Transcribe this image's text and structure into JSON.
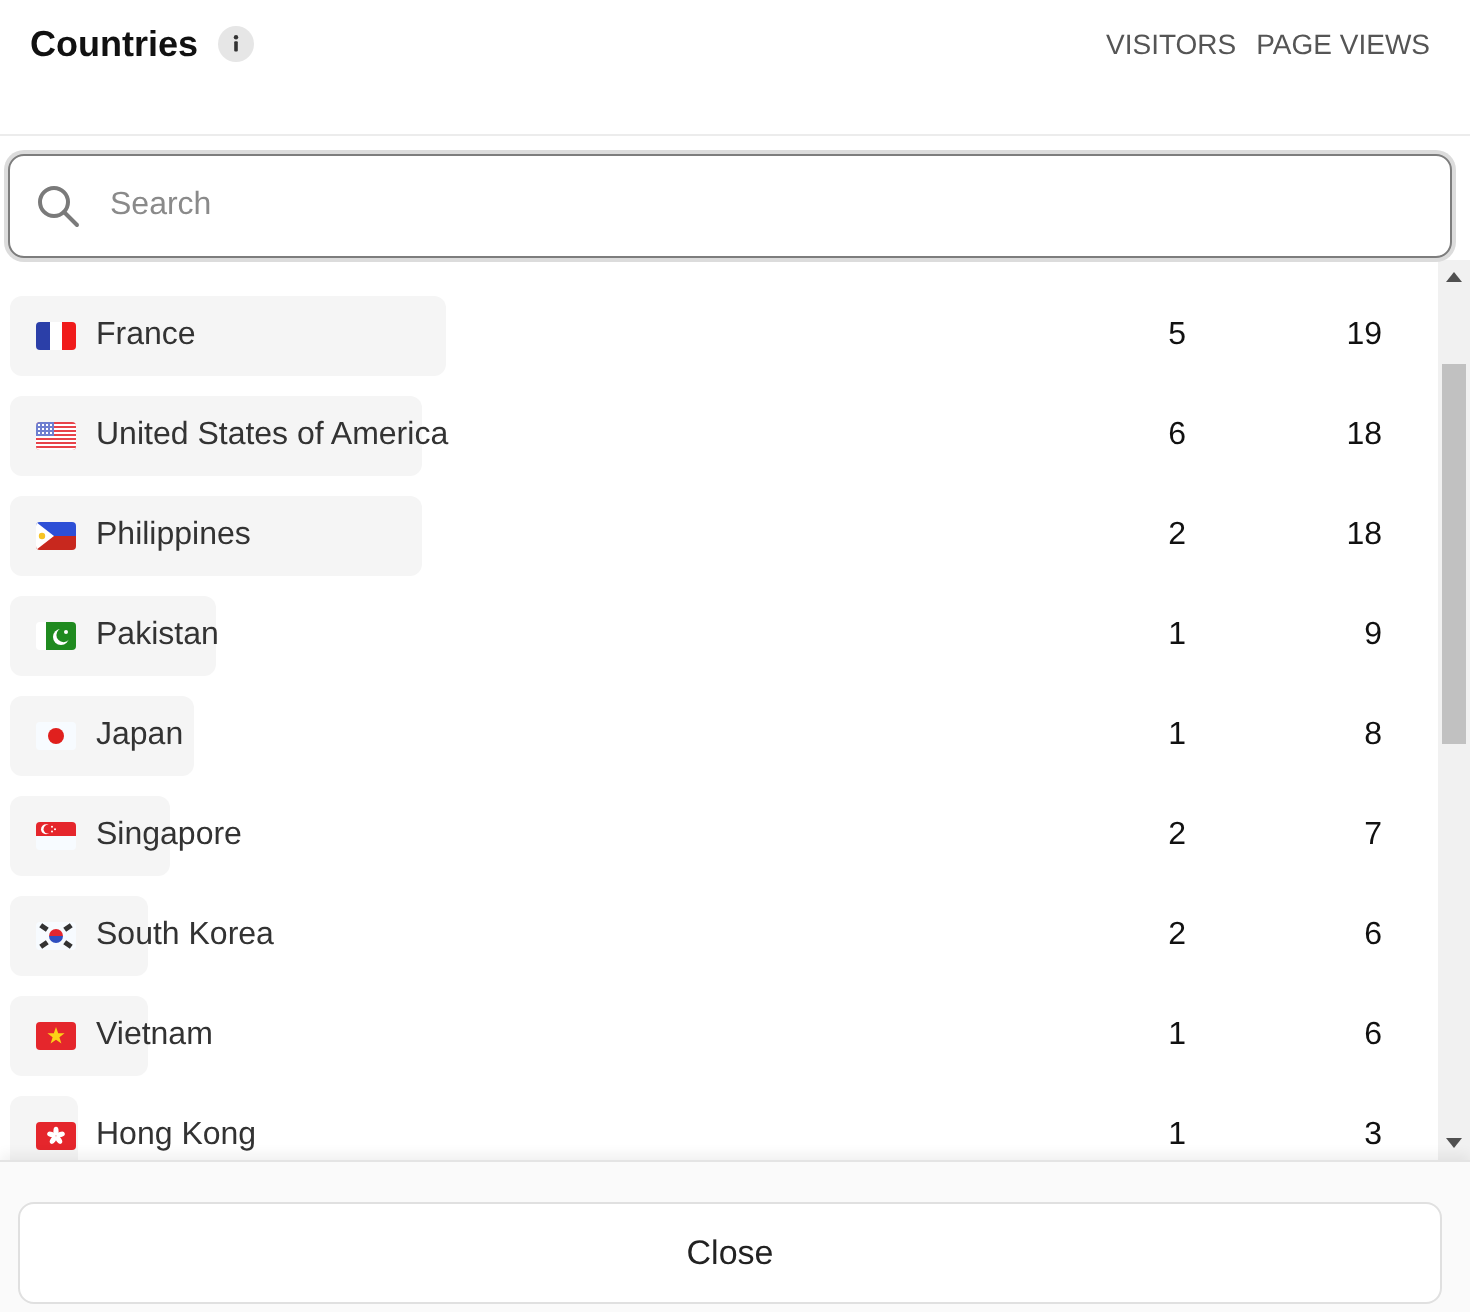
{
  "header": {
    "title": "Countries",
    "columns": [
      "VISITORS",
      "PAGE VIEWS"
    ]
  },
  "search": {
    "placeholder": "Search"
  },
  "rows": [
    {
      "kind": "fr",
      "name": "France",
      "visitors": "5",
      "page_views": "19",
      "level": 0.305
    },
    {
      "kind": "us",
      "name": "United States of America",
      "visitors": "6",
      "page_views": "18",
      "level": 0.289
    },
    {
      "kind": "ph",
      "name": "Philippines",
      "visitors": "2",
      "page_views": "18",
      "level": 0.289
    },
    {
      "kind": "pk",
      "name": "Pakistan",
      "visitors": "1",
      "page_views": "9",
      "level": 0.144
    },
    {
      "kind": "jp",
      "name": "Japan",
      "visitors": "1",
      "page_views": "8",
      "level": 0.129
    },
    {
      "kind": "sg",
      "name": "Singapore",
      "visitors": "2",
      "page_views": "7",
      "level": 0.112
    },
    {
      "kind": "kr",
      "name": "South Korea",
      "visitors": "2",
      "page_views": "6",
      "level": 0.097
    },
    {
      "kind": "vn",
      "name": "Vietnam",
      "visitors": "1",
      "page_views": "6",
      "level": 0.097
    },
    {
      "kind": "hk",
      "name": "Hong Kong",
      "visitors": "1",
      "page_views": "3",
      "level": 0.048
    }
  ],
  "close_button": "Close"
}
